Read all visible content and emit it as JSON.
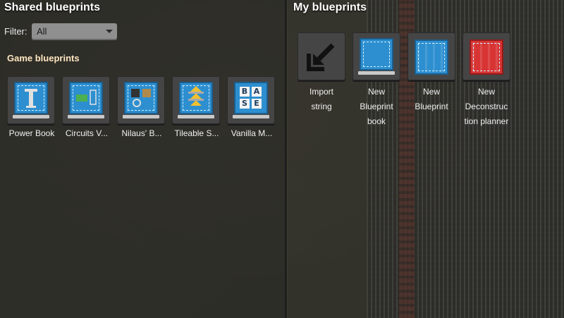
{
  "shared": {
    "title": "Shared blueprints",
    "filter_label": "Filter:",
    "filter_value": "All",
    "section_title": "Game blueprints",
    "items": [
      {
        "label": "Power Book",
        "icon": "power-pole-icon"
      },
      {
        "label": "Circuits V...",
        "icon": "circuit-icon"
      },
      {
        "label": "Nilaus' B...",
        "icon": "machines-icon"
      },
      {
        "label": "Tileable S...",
        "icon": "tileable-icon"
      },
      {
        "label": "Vanilla M...",
        "icon": "base-letters-icon",
        "letters": [
          "B",
          "A",
          "S",
          "E"
        ]
      }
    ]
  },
  "mine": {
    "title": "My blueprints",
    "items": [
      {
        "label": "Import string",
        "line1": "Import",
        "line2": "string",
        "icon": "import-arrow-icon"
      },
      {
        "label": "New Blueprint book",
        "line1": "New",
        "line2": "Blueprint",
        "line3": "book",
        "icon": "blueprint-book-icon"
      },
      {
        "label": "New Blueprint",
        "line1": "New",
        "line2": "Blueprint",
        "icon": "blueprint-icon"
      },
      {
        "label": "New Deconstruction planner",
        "line1": "New",
        "line2": "Deconstruc",
        "line3": "tion planner",
        "icon": "deconstruction-planner-icon"
      }
    ]
  },
  "colors": {
    "blueprint": "#2d8fd0",
    "deconstruction": "#d83434",
    "slot": "#454545"
  }
}
